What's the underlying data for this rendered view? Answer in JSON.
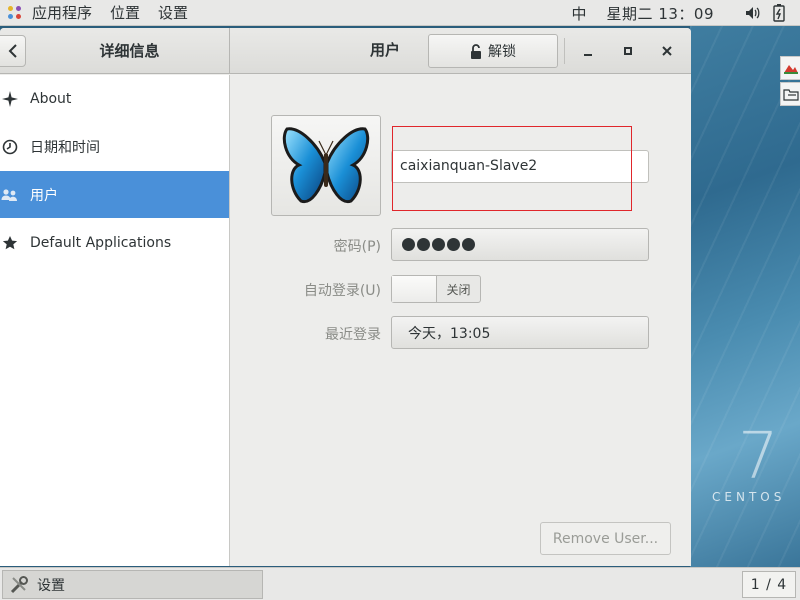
{
  "top_panel": {
    "applications_label": "应用程序",
    "places_label": "位置",
    "settings_label": "设置",
    "input_method": "中",
    "clock": "星期二 13：09",
    "icons": [
      "apps-icon",
      "volume-icon",
      "battery-icon"
    ]
  },
  "desktop": {
    "brand_number": "7",
    "brand_word": "CENTOS"
  },
  "header": {
    "sidebar_title": "详细信息",
    "page_title": "用户",
    "unlock_label": "解锁"
  },
  "sidebar": {
    "items": [
      {
        "label": "About",
        "icon": "star-spark-icon",
        "active": false
      },
      {
        "label": "日期和时间",
        "icon": "clock-icon",
        "active": false
      },
      {
        "label": "用户",
        "icon": "users-icon",
        "active": true
      },
      {
        "label": "Default Applications",
        "icon": "star-icon",
        "active": false
      }
    ]
  },
  "user": {
    "name": "caixianquan-Slave2",
    "password_label": "密码(P)",
    "password_mnemonic": "P",
    "autologin_label": "自动登录(U)",
    "autologin_state": "关闭",
    "last_login_label": "最近登录",
    "last_login_value": "今天，13:05",
    "remove_label": "Remove User..."
  },
  "taskbar": {
    "task_label": "设置",
    "workspace": "1 / 4"
  },
  "colors": {
    "accent": "#4a90d9",
    "highlight_box": "#e0262b"
  }
}
